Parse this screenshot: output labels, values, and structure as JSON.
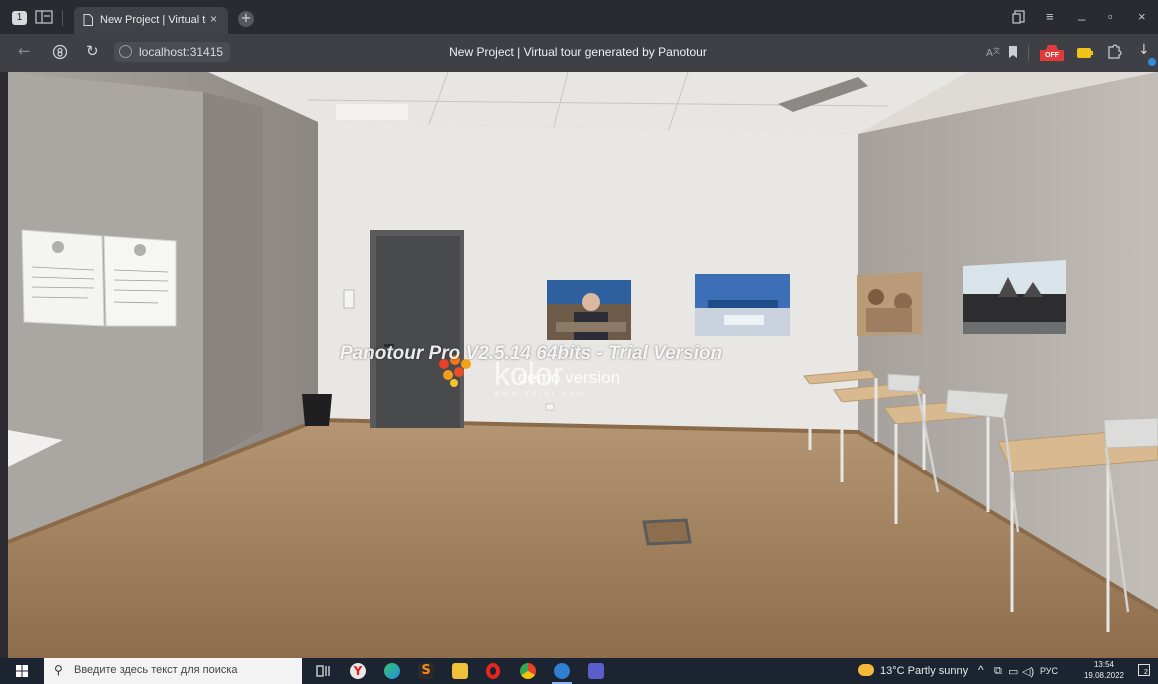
{
  "browser": {
    "tab_count": "1",
    "tab_title": "New Project | Virtual tou",
    "tab_close": "×",
    "new_tab": "+",
    "url": "localhost:31415",
    "page_title": "New Project | Virtual tour generated by Panotour",
    "window_controls": {
      "minimize": "_",
      "maximize": "▫",
      "close": "×",
      "menu": "≡"
    },
    "adblock_badge": "OFF"
  },
  "viewer": {
    "watermark_pro": "Panotour Pro V2.5.14 64bits - Trial Version",
    "watermark_kolor": "kolor",
    "watermark_demo": "demo version",
    "watermark_www": "www.kolor.com"
  },
  "taskbar": {
    "search_placeholder": "Введите здесь текст для поиска",
    "weather": "13°C  Partly sunny",
    "language": "РУС",
    "time": "13:54",
    "date": "19.08.2022",
    "notification_count": "2"
  },
  "colors": {
    "tab_strip": "#2a2a31",
    "address_bar": "#3f3f46",
    "taskbar": "#1b2430",
    "wall": "#e9e7e3",
    "floor": "#a4835f"
  }
}
